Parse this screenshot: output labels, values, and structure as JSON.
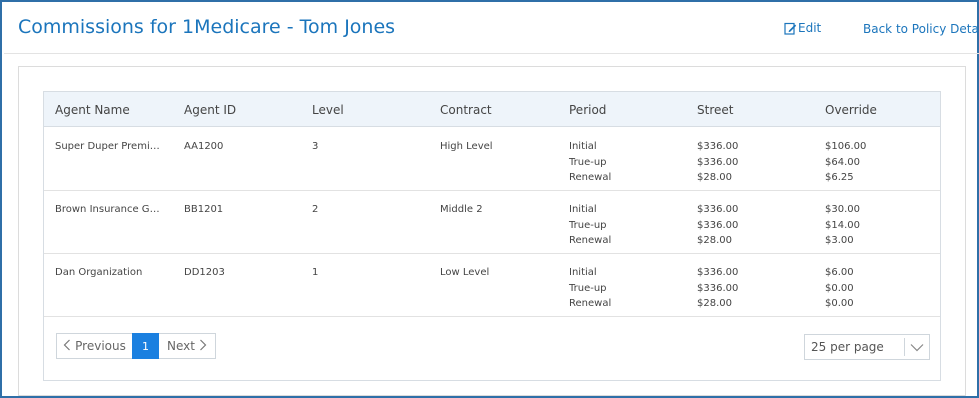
{
  "header": {
    "title": "Commissions for 1Medicare - Tom Jones",
    "edit_label": "Edit",
    "back_label": "Back to Policy Details"
  },
  "table": {
    "columns": [
      "Agent Name",
      "Agent ID",
      "Level",
      "Contract",
      "Period",
      "Street",
      "Override"
    ],
    "rows": [
      {
        "agent_name": "Super Duper Premium ...",
        "agent_id": "AA1200",
        "level": "3",
        "contract": "High Level",
        "periods": [
          "Initial",
          "True-up",
          "Renewal"
        ],
        "street": [
          "$336.00",
          "$336.00",
          "$28.00"
        ],
        "override": [
          "$106.00",
          "$64.00",
          "$6.25"
        ]
      },
      {
        "agent_name": "Brown Insurance Group",
        "agent_id": "BB1201",
        "level": "2",
        "contract": "Middle 2",
        "periods": [
          "Initial",
          "True-up",
          "Renewal"
        ],
        "street": [
          "$336.00",
          "$336.00",
          "$28.00"
        ],
        "override": [
          "$30.00",
          "$14.00",
          "$3.00"
        ]
      },
      {
        "agent_name": "Dan Organization",
        "agent_id": "DD1203",
        "level": "1",
        "contract": "Low Level",
        "periods": [
          "Initial",
          "True-up",
          "Renewal"
        ],
        "street": [
          "$336.00",
          "$336.00",
          "$28.00"
        ],
        "override": [
          "$6.00",
          "$0.00",
          "$0.00"
        ]
      }
    ]
  },
  "pagination": {
    "previous_label": "Previous",
    "current_page": "1",
    "next_label": "Next",
    "per_page": "25 per page"
  },
  "colors": {
    "accent": "#1b75bc",
    "active_page": "#1b80e0",
    "header_bg": "#eef4fa"
  }
}
